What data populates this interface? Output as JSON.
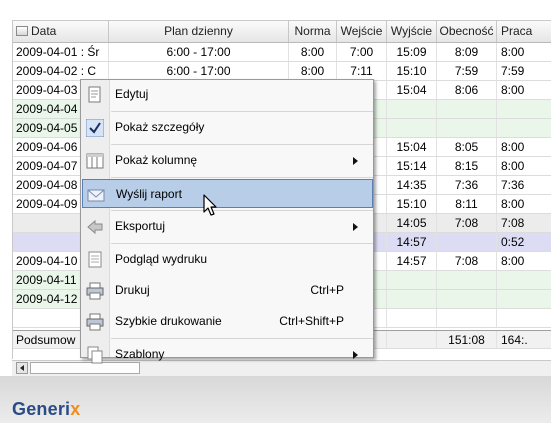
{
  "table": {
    "columns": [
      "Data",
      "Plan dzienny",
      "Norma",
      "Wejście",
      "Wyjście",
      "Obecność",
      "Praca"
    ],
    "rows": [
      {
        "style": "white",
        "cells": [
          "2009-04-01 : Śr",
          "6:00 - 17:00",
          "8:00",
          "7:00",
          "15:09",
          "8:09",
          "8:00"
        ]
      },
      {
        "style": "white",
        "cells": [
          "2009-04-02 : C",
          "6:00 - 17:00",
          "8:00",
          "7:11",
          "15:10",
          "7:59",
          "7:59"
        ]
      },
      {
        "style": "white",
        "cells": [
          "2009-04-03",
          "",
          "",
          "",
          "15:04",
          "8:06",
          "8:00"
        ]
      },
      {
        "style": "green",
        "cells": [
          "2009-04-04",
          "",
          "",
          "",
          "",
          "",
          ""
        ]
      },
      {
        "style": "green",
        "cells": [
          "2009-04-05",
          "",
          "",
          "",
          "",
          "",
          ""
        ]
      },
      {
        "style": "white",
        "cells": [
          "2009-04-06",
          "",
          "",
          "",
          "15:04",
          "8:05",
          "8:00"
        ]
      },
      {
        "style": "white",
        "cells": [
          "2009-04-07",
          "",
          "",
          "",
          "15:14",
          "8:15",
          "8:00"
        ]
      },
      {
        "style": "white",
        "cells": [
          "2009-04-08",
          "",
          "",
          "",
          "14:35",
          "7:36",
          "7:36"
        ]
      },
      {
        "style": "white",
        "cells": [
          "2009-04-09",
          "",
          "",
          "",
          "15:10",
          "8:11",
          "8:00"
        ]
      },
      {
        "style": "hl",
        "cells": [
          "",
          "",
          "",
          "",
          "14:05",
          "7:08",
          "7:08"
        ]
      },
      {
        "style": "hl2",
        "cells": [
          "",
          "",
          "",
          "5",
          "14:57",
          "",
          "0:52"
        ]
      },
      {
        "style": "white",
        "cells": [
          "2009-04-10",
          "",
          "",
          "",
          "14:57",
          "7:08",
          "8:00"
        ]
      },
      {
        "style": "green",
        "cells": [
          "2009-04-11",
          "",
          "",
          "",
          "",
          "",
          ""
        ]
      },
      {
        "style": "green",
        "cells": [
          "2009-04-12",
          "",
          "",
          "",
          "",
          "",
          ""
        ]
      },
      {
        "style": "blank",
        "cells": [
          "",
          "",
          "",
          "",
          "",
          "",
          ""
        ]
      },
      {
        "style": "sum",
        "cells": [
          "Podsumow",
          "",
          "",
          "",
          "",
          "151:08",
          "164:."
        ]
      }
    ]
  },
  "menu": {
    "items": [
      {
        "label": "Edytuj",
        "icon": "edit-page-icon"
      },
      {
        "label": "Pokaż szczegóły",
        "icon": "checkmark-icon"
      },
      {
        "label": "Pokaż kolumnę",
        "icon": "columns-grid-icon",
        "submenu": true
      },
      {
        "label": "Wyślij raport",
        "icon": "mail-envelope-icon",
        "selected": true
      },
      {
        "label": "Eksportuj",
        "icon": "export-arrow-icon",
        "submenu": true
      },
      {
        "label": "Podgląd wydruku",
        "icon": "print-preview-icon"
      },
      {
        "label": "Drukuj",
        "icon": "printer-icon",
        "shortcut": "Ctrl+P"
      },
      {
        "label": "Szybkie drukowanie",
        "icon": "quick-print-icon",
        "shortcut": "Ctrl+Shift+P"
      },
      {
        "label": "Szablony",
        "icon": "templates-icon",
        "submenu": true
      }
    ]
  },
  "brand": {
    "logo_main": "Generi",
    "logo_accent": "x",
    "color_main": "#2b4b86",
    "color_accent": "#f08d1d"
  }
}
